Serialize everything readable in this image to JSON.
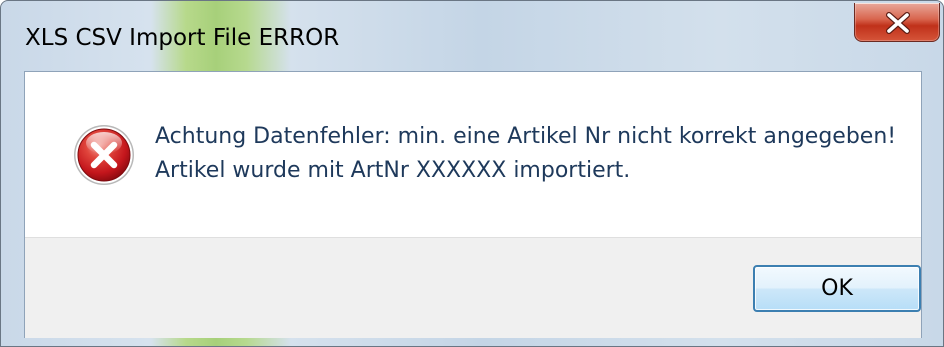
{
  "window": {
    "title": "XLS CSV Import File ERROR"
  },
  "close_button": {
    "icon": "close-icon"
  },
  "message": {
    "icon": "error-icon",
    "line1": "Achtung Datenfehler: min. eine Artikel Nr nicht korrekt angegeben!",
    "line2": "Artikel wurde mit ArtNr XXXXXX importiert."
  },
  "buttons": {
    "ok_label": "OK"
  },
  "colors": {
    "message_text": "#1e395b",
    "close_button_red": "#c0311a",
    "error_icon_red": "#c4161c",
    "ok_button_border": "#3c7fb1"
  }
}
